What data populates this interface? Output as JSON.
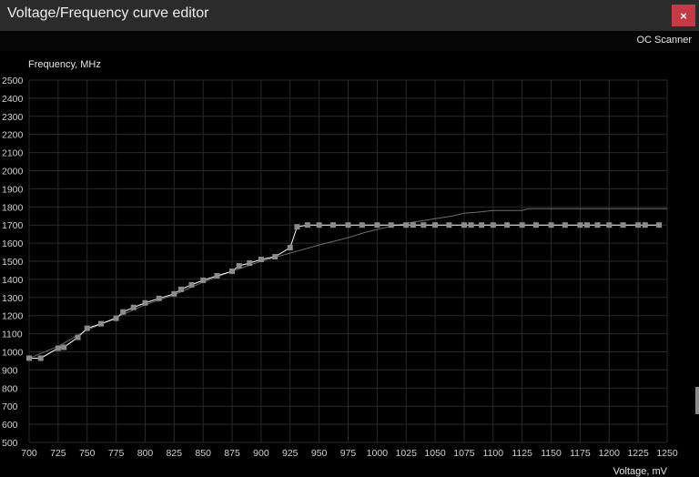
{
  "window": {
    "title": "Voltage/Frequency curve editor",
    "close_glyph": "×",
    "close_color": "#c53a44"
  },
  "toolbar": {
    "oc_scanner_label": "OC Scanner"
  },
  "chart_data": {
    "type": "line",
    "ylabel": "Frequency, MHz",
    "xlabel": "Voltage, mV",
    "xlim": [
      700,
      1250
    ],
    "ylim": [
      500,
      2500
    ],
    "x_ticks": [
      700,
      725,
      750,
      775,
      800,
      825,
      850,
      875,
      900,
      925,
      950,
      975,
      1000,
      1025,
      1050,
      1075,
      1100,
      1125,
      1150,
      1175,
      1200,
      1225,
      1250
    ],
    "y_ticks": [
      500,
      600,
      700,
      800,
      900,
      1000,
      1100,
      1200,
      1300,
      1400,
      1500,
      1600,
      1700,
      1800,
      1900,
      2000,
      2100,
      2200,
      2300,
      2400,
      2500
    ],
    "grid": true,
    "colors": {
      "background": "#000000",
      "grid": "#2a2a2a",
      "curve": "#ffffff",
      "point": "#8c8c8c",
      "default_curve": "#6e6e6e"
    },
    "series": [
      {
        "x": [
          700,
          710,
          725,
          730,
          742,
          750,
          762,
          775,
          781,
          790,
          800,
          812,
          825,
          831,
          840,
          850,
          862,
          875,
          881,
          890,
          900,
          912,
          925,
          931,
          940,
          950,
          962,
          975,
          987,
          1000,
          1012,
          1025,
          1031,
          1040,
          1050,
          1062,
          1075,
          1081,
          1090,
          1100,
          1112,
          1125,
          1137,
          1150,
          1162,
          1175,
          1181,
          1190,
          1200,
          1212,
          1225,
          1231,
          1243
        ],
        "y": [
          965,
          965,
          1020,
          1025,
          1080,
          1130,
          1155,
          1185,
          1220,
          1245,
          1270,
          1295,
          1320,
          1345,
          1370,
          1395,
          1420,
          1445,
          1475,
          1490,
          1510,
          1525,
          1575,
          1690,
          1700,
          1700,
          1700,
          1700,
          1700,
          1700,
          1700,
          1700,
          1700,
          1700,
          1700,
          1700,
          1700,
          1700,
          1700,
          1700,
          1700,
          1700,
          1700,
          1700,
          1700,
          1700,
          1700,
          1700,
          1700,
          1700,
          1700,
          1700,
          1700
        ]
      },
      {
        "x": [
          700,
          725,
          750,
          775,
          800,
          825,
          850,
          875,
          900,
          925,
          950,
          975,
          990,
          1010,
          1030,
          1050,
          1065,
          1075,
          1085,
          1100,
          1125,
          1130,
          1250
        ],
        "y": [
          965,
          1030,
          1120,
          1190,
          1260,
          1315,
          1385,
          1445,
          1500,
          1545,
          1590,
          1630,
          1660,
          1690,
          1715,
          1735,
          1750,
          1765,
          1770,
          1780,
          1780,
          1790,
          1790
        ]
      }
    ]
  }
}
